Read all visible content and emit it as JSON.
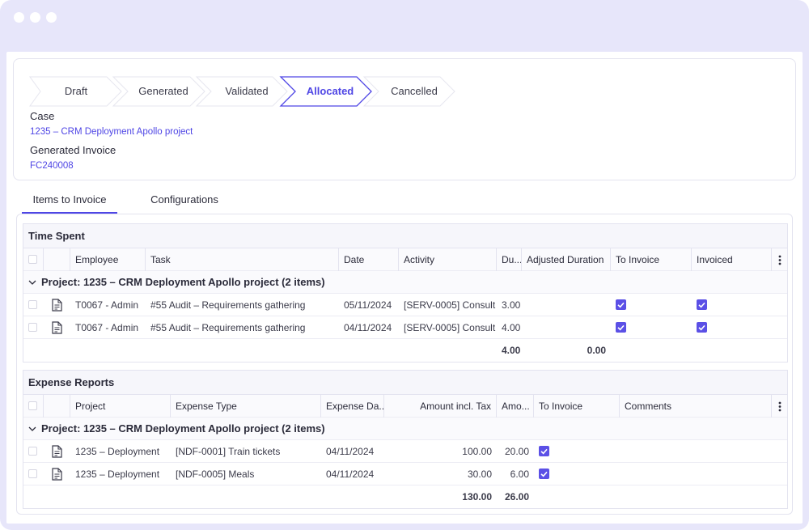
{
  "window": {
    "dots": 3
  },
  "steps": [
    {
      "label": "Draft",
      "active": false
    },
    {
      "label": "Generated",
      "active": false
    },
    {
      "label": "Validated",
      "active": false
    },
    {
      "label": "Allocated",
      "active": true
    },
    {
      "label": "Cancelled",
      "active": false
    }
  ],
  "case": {
    "label": "Case",
    "value": "1235 – CRM Deployment Apollo project"
  },
  "invoice": {
    "label": "Generated Invoice",
    "value": "FC240008"
  },
  "tabs": [
    {
      "label": "Items to Invoice",
      "active": true
    },
    {
      "label": "Configurations",
      "active": false
    }
  ],
  "time_spent": {
    "title": "Time Spent",
    "columns": [
      "Employee",
      "Task",
      "Date",
      "Activity",
      "Du...",
      "Adjusted Duration",
      "To Invoice",
      "Invoiced"
    ],
    "group": "Project: 1235 – CRM Deployment Apollo project (2 items)",
    "rows": [
      {
        "employee": "T0067 - Admin",
        "task": "#55 Audit – Requirements gathering",
        "date": "05/11/2024",
        "activity": "[SERV-0005] Consult",
        "duration": "3.00",
        "to_invoice": true,
        "invoiced": true
      },
      {
        "employee": "T0067 - Admin",
        "task": "#55 Audit – Requirements gathering",
        "date": "04/11/2024",
        "activity": "[SERV-0005] Consult",
        "duration": "4.00",
        "to_invoice": true,
        "invoiced": true
      }
    ],
    "totals": {
      "duration": "4.00",
      "adjusted": "0.00"
    }
  },
  "expenses": {
    "title": "Expense Reports",
    "columns": [
      "Project",
      "Expense Type",
      "Expense Da...",
      "Amount incl. Tax",
      "Amo...",
      "To Invoice",
      "Comments"
    ],
    "group": "Project: 1235 – CRM Deployment Apollo project (2 items)",
    "rows": [
      {
        "project": "1235 – Deployment",
        "type": "[NDF-0001] Train tickets",
        "date": "04/11/2024",
        "amount": "100.00",
        "amo": "20.00",
        "to_invoice": true
      },
      {
        "project": "1235 – Deployment",
        "type": "[NDF-0005] Meals",
        "date": "04/11/2024",
        "amount": "30.00",
        "amo": "6.00",
        "to_invoice": true
      }
    ],
    "totals": {
      "amount": "130.00",
      "amo": "26.00"
    }
  },
  "colors": {
    "accent": "#4f46e5",
    "frame": "#e7e6fa",
    "checkbox": "#5b50e6"
  },
  "icons": [
    "document-icon",
    "kebab-menu-icon",
    "chevron-down-icon",
    "checkbox-checked-icon"
  ]
}
